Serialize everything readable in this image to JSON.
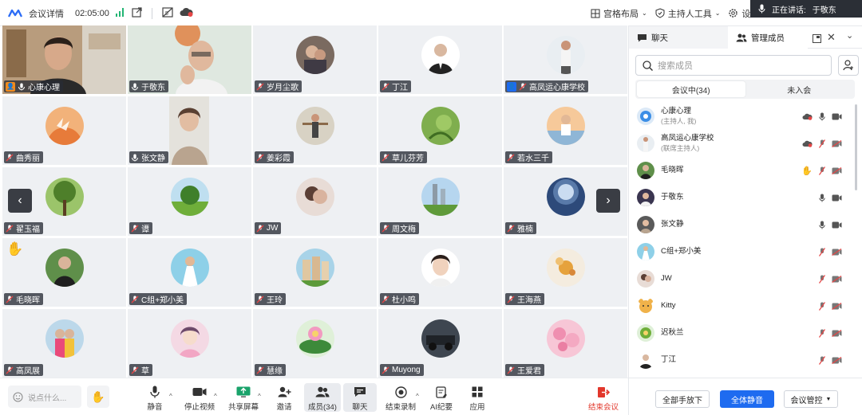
{
  "topbar": {
    "meeting_details": "会议详情",
    "duration": "02:05:00",
    "gallery_layout": "宫格布局",
    "host_tools": "主持人工具",
    "settings": "设置"
  },
  "speaking": {
    "label": "正在讲话:",
    "name": "于敬东"
  },
  "grid": {
    "tiles": [
      {
        "name": "心康心理"
      },
      {
        "name": "于敬东"
      },
      {
        "name": "岁月尘歌"
      },
      {
        "name": "丁江"
      },
      {
        "name": "高凤运心康学校"
      },
      {
        "name": "曲秀丽"
      },
      {
        "name": "张文静"
      },
      {
        "name": "姜彩霞"
      },
      {
        "name": "草儿芬芳"
      },
      {
        "name": "若水三千"
      },
      {
        "name": "翟玉福"
      },
      {
        "name": "谭"
      },
      {
        "name": "JW"
      },
      {
        "name": "周文梅"
      },
      {
        "name": "雅楠"
      },
      {
        "name": "毛晓晖"
      },
      {
        "name": "C组+郑小美"
      },
      {
        "name": "王玲"
      },
      {
        "name": "杜小鸣"
      },
      {
        "name": "王海燕"
      },
      {
        "name": "高凤展"
      },
      {
        "name": "草"
      },
      {
        "name": "慧缘"
      },
      {
        "name": "Muyong"
      },
      {
        "name": "王爱君"
      }
    ]
  },
  "bottombar": {
    "say_placeholder": "说点什么...",
    "mute": "静音",
    "stop_video": "停止视频",
    "share_screen": "共享屏幕",
    "invite": "邀请",
    "members": "成员(34)",
    "chat": "聊天",
    "end_recording": "结束录制",
    "ai_minutes": "AI纪要",
    "apps": "应用",
    "end_meeting": "结束会议"
  },
  "panel": {
    "tab_chat": "聊天",
    "tab_members": "管理成员",
    "search_placeholder": "搜索成员",
    "seg_in_meeting": "会议中(34)",
    "seg_not_joined": "未入会",
    "members": [
      {
        "name": "心康心理",
        "role": "(主持人, 我)"
      },
      {
        "name": "高凤运心康学校",
        "role": "(联席主持人)"
      },
      {
        "name": "毛晓晖",
        "role": ""
      },
      {
        "name": "于敬东",
        "role": ""
      },
      {
        "name": "张文静",
        "role": ""
      },
      {
        "name": "C组+郑小美",
        "role": ""
      },
      {
        "name": "JW",
        "role": ""
      },
      {
        "name": "Kitty",
        "role": ""
      },
      {
        "name": "迟秋兰",
        "role": ""
      },
      {
        "name": "丁江",
        "role": ""
      }
    ],
    "btn_lower_all_hands": "全部手放下",
    "btn_mute_all": "全体静音",
    "btn_meeting_control": "会议管控"
  },
  "colors": {
    "primary": "#1e6bf0",
    "active_border": "#26c281",
    "end_red": "#e2372b",
    "muted_red": "#e64545"
  }
}
